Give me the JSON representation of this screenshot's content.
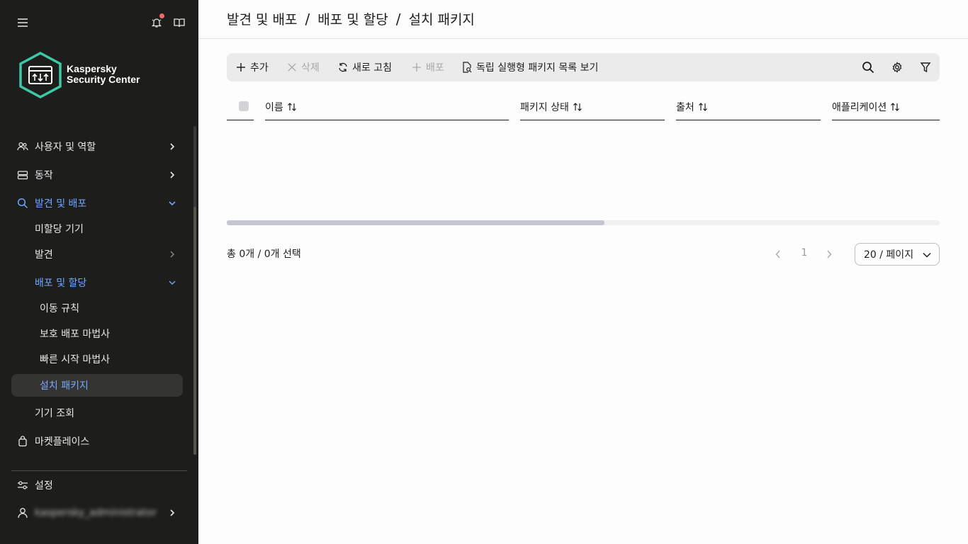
{
  "sidebar": {
    "logo": {
      "line1": "Kaspersky",
      "line2": "Security Center"
    },
    "items": [
      {
        "label": "사용자 및 역할",
        "icon": "users-icon"
      },
      {
        "label": "동작",
        "icon": "server-icon"
      },
      {
        "label": "발견 및 배포",
        "icon": "search-icon"
      },
      {
        "label": "미할당 기기"
      },
      {
        "label": "발견"
      },
      {
        "label": "배포 및 할당"
      },
      {
        "label": "이동 규칙"
      },
      {
        "label": "보호 배포 마법사"
      },
      {
        "label": "빠른 시작 마법사"
      },
      {
        "label": "설치 패키지"
      },
      {
        "label": "기기 조회"
      },
      {
        "label": "마켓플레이스",
        "icon": "bag-icon"
      }
    ],
    "settings_label": "설정",
    "user_label": "kaspersky_administrator"
  },
  "breadcrumb": {
    "part1": "발견 및 배포",
    "part2": "배포 및 할당",
    "part3": "설치 패키지",
    "separator": "/"
  },
  "toolbar": {
    "add": "추가",
    "delete": "삭제",
    "refresh": "새로 고침",
    "deploy": "배포",
    "standalone": "독립 실행형 패키지 목록 보기"
  },
  "table": {
    "columns": [
      "이름",
      "패키지 상태",
      "출처",
      "애플리케이션"
    ],
    "rows": []
  },
  "footer": {
    "total": "총 0개 / 0개 선택",
    "page": "1",
    "per_page": "20 / 페이지"
  },
  "colors": {
    "accent": "#6fa6ff",
    "sidebar_bg": "#1d1d1b",
    "notification": "#ee6c63"
  }
}
